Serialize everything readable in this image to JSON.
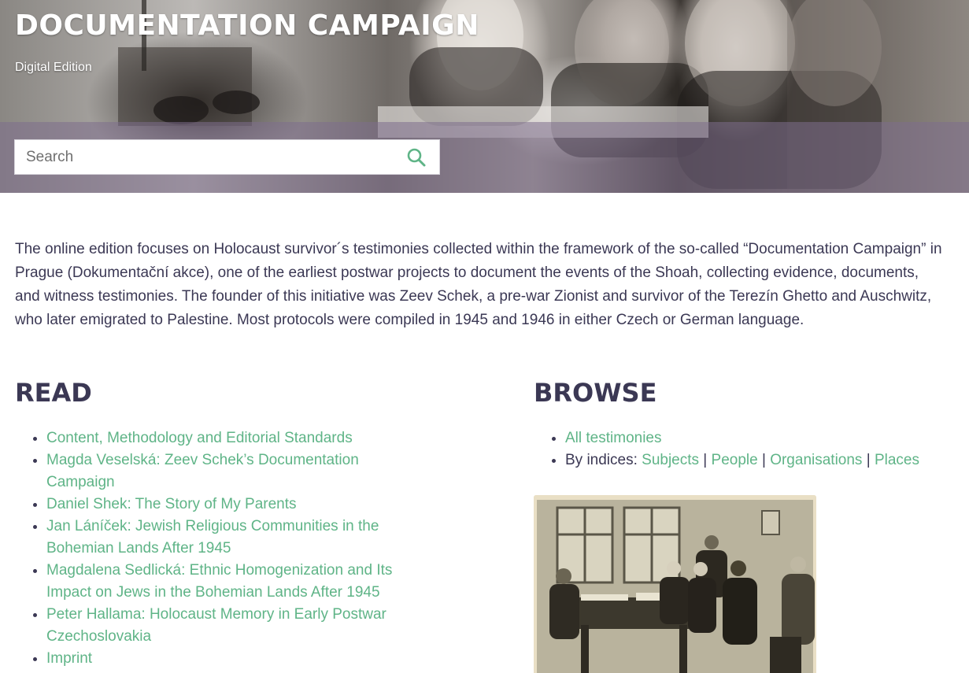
{
  "header": {
    "title": "DOCUMENTATION CAMPAIGN",
    "subtitle": "Digital Edition"
  },
  "search": {
    "placeholder": "Search",
    "value": ""
  },
  "intro": "The online edition focuses on Holocaust survivor´s testimonies collected within the framework of the so-called “Documentation Campaign” in Prague (Dokumentační akce), one of the earliest postwar projects to document the events of the Shoah, collecting evidence, documents, and witness testimonies. The founder of this initiative was Zeev Schek, a pre-war Zionist and survivor of the Terezín Ghetto and Auschwitz, who later emigrated to Palestine. Most protocols were compiled in 1945 and 1946 in either Czech or German language.",
  "read": {
    "title": "READ",
    "items": [
      "Content, Methodology and Editorial Standards",
      "Magda Veselská: Zeev Schek’s Documentation Campaign",
      "Daniel Shek: The Story of My Parents",
      "Jan Láníček: Jewish Religious Communities in the Bohemian Lands After 1945",
      "Magdalena Sedlická: Ethnic Homogenization and Its Impact on Jews in the Bohemian Lands After 1945",
      "Peter Hallama: Holocaust Memory in Early Postwar Czechoslovakia",
      "Imprint"
    ]
  },
  "browse": {
    "title": "BROWSE",
    "all_testimonies": "All testimonies",
    "indices_label": "By indices: ",
    "indices": [
      "Subjects",
      "People",
      "Organisations",
      "Places"
    ],
    "separator": " | "
  },
  "icons": {
    "search": "search-icon"
  },
  "colors": {
    "link": "#5fb487",
    "text": "#3b3854",
    "header_overlay": "#7d6e8c"
  }
}
